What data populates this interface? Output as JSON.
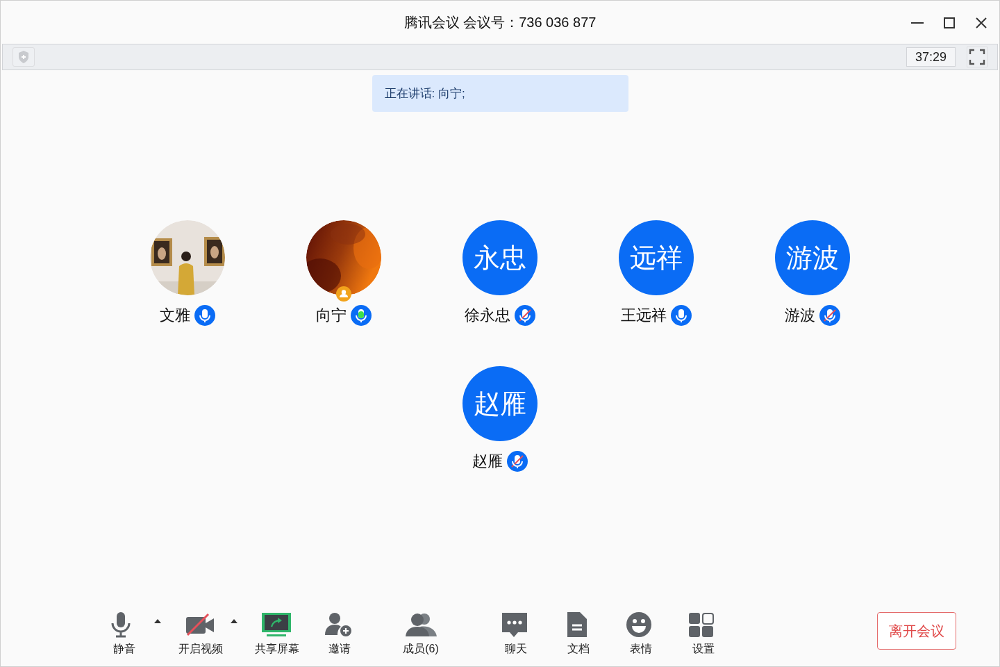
{
  "window": {
    "title": "腾讯会议 会议号：736 036 877"
  },
  "info_bar": {
    "timer": "37:29"
  },
  "speaking_banner": {
    "text": "正在讲话: 向宁;"
  },
  "participants": [
    {
      "name": "文雅",
      "muted": false,
      "speaking": false,
      "host": false
    },
    {
      "name": "向宁",
      "avatar": {
        "kind": "gradient"
      },
      "muted": false,
      "speaking": true,
      "host": true
    },
    {
      "name": "徐永忠",
      "avatar": {
        "kind": "initials",
        "text": "永忠"
      },
      "muted": true,
      "speaking": false,
      "host": false
    },
    {
      "name": "王远祥",
      "avatar": {
        "kind": "initials",
        "text": "远祥"
      },
      "muted": false,
      "speaking": false,
      "host": false
    },
    {
      "name": "游波",
      "avatar": {
        "kind": "initials",
        "text": "游波"
      },
      "muted": true,
      "speaking": false,
      "host": false
    },
    {
      "name": "赵雁",
      "avatar": {
        "kind": "initials",
        "text": "赵雁"
      },
      "muted": true,
      "speaking": false,
      "host": false
    }
  ],
  "toolbar": [
    {
      "kind": "mic",
      "label": "静音",
      "menu": true
    },
    {
      "kind": "video",
      "label": "开启视频",
      "menu": true,
      "on": false
    },
    {
      "kind": "share",
      "label": "共享屏幕",
      "menu": false
    },
    {
      "kind": "invite",
      "label": "邀请",
      "menu": false
    },
    {
      "kind": "members",
      "label": "成员(6)",
      "menu": false
    },
    {
      "kind": "chat",
      "label": "聊天",
      "menu": false
    },
    {
      "kind": "docs",
      "label": "文档",
      "menu": false
    },
    {
      "kind": "emoji",
      "label": "表情",
      "menu": false
    },
    {
      "kind": "settings",
      "label": "设置",
      "menu": false
    }
  ],
  "leave_button": {
    "label": "离开会议"
  }
}
